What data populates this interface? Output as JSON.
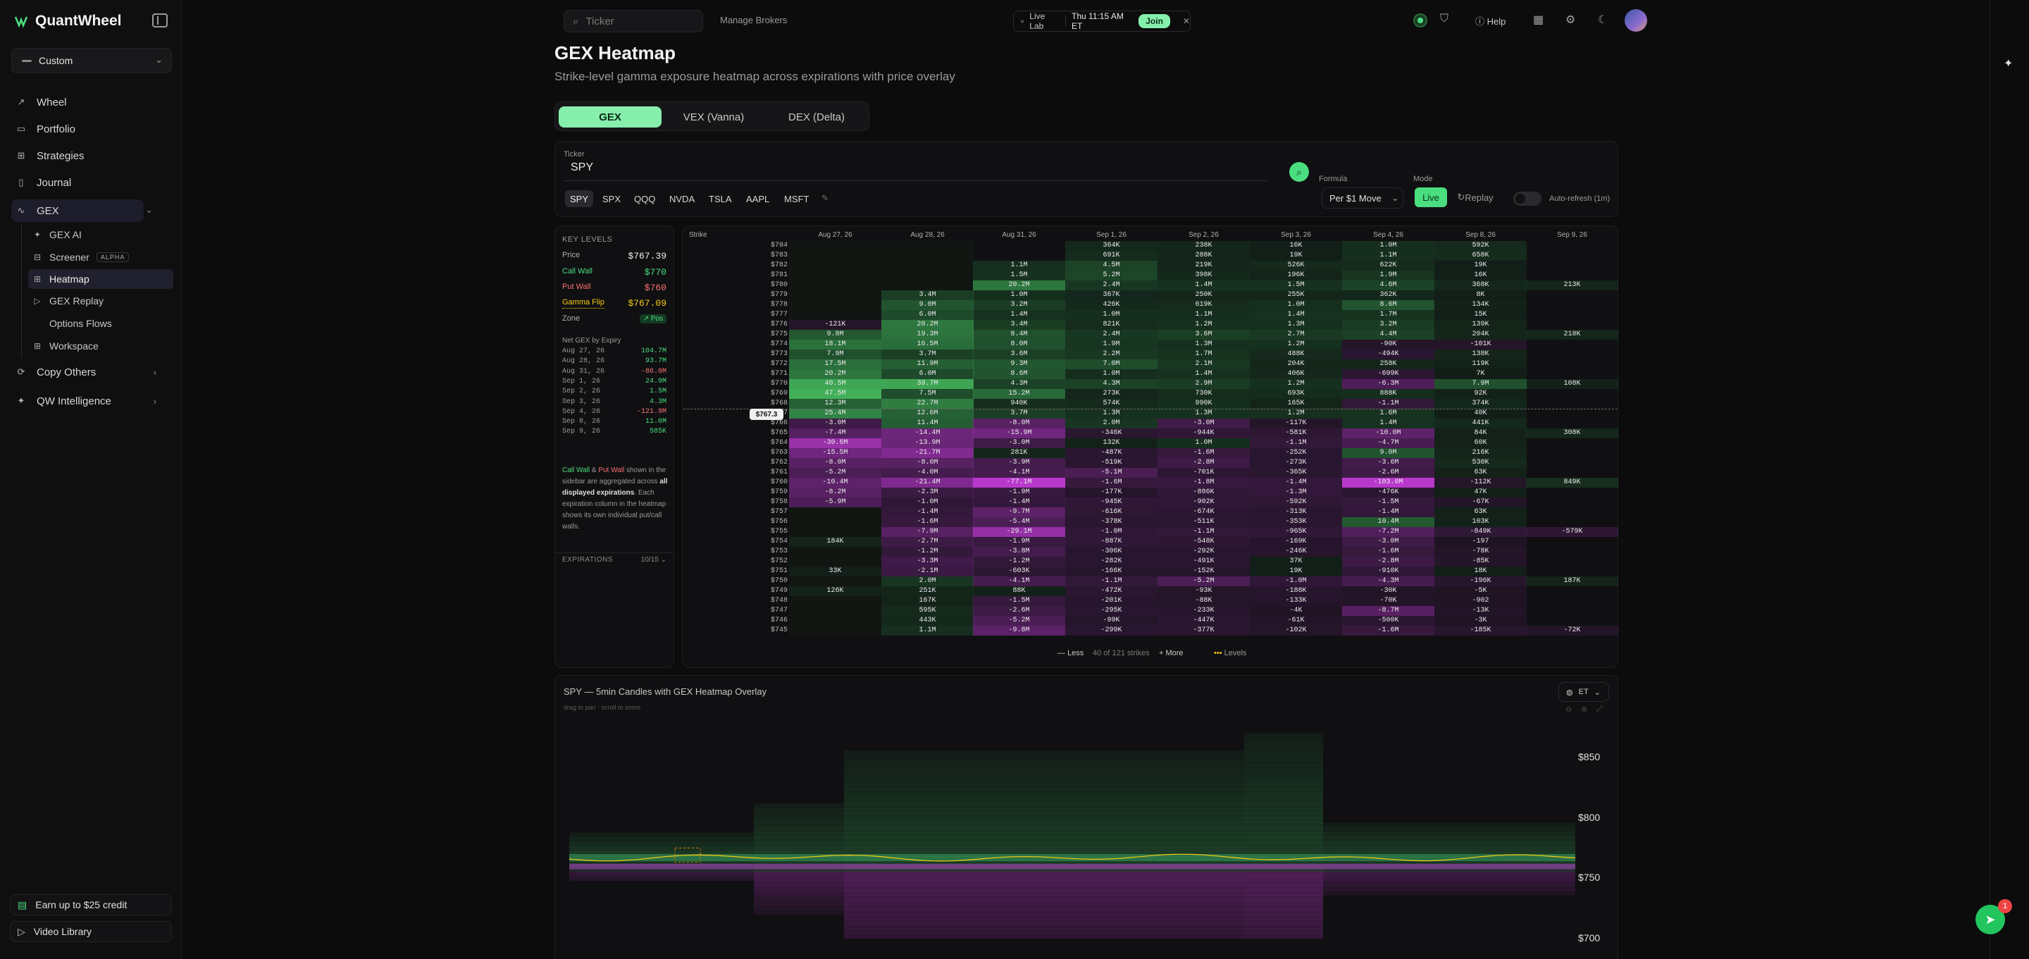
{
  "app": {
    "name": "QuantWheel"
  },
  "sidebar": {
    "preset": "Custom",
    "items": [
      {
        "label": "Wheel",
        "icon": "wheel-icon"
      },
      {
        "label": "Portfolio",
        "icon": "portfolio-icon"
      },
      {
        "label": "Strategies",
        "icon": "strategies-icon"
      },
      {
        "label": "Journal",
        "icon": "journal-icon"
      },
      {
        "label": "GEX",
        "icon": "gex-icon"
      },
      {
        "label": "Copy Others",
        "icon": "copy-icon"
      },
      {
        "label": "QW Intelligence",
        "icon": "sparkle-icon"
      }
    ],
    "gex_sub": [
      {
        "label": "GEX AI",
        "icon": "sparkle-icon"
      },
      {
        "label": "Screener",
        "icon": "screener-icon",
        "badge": "ALPHA"
      },
      {
        "label": "Heatmap",
        "icon": "grid-icon"
      },
      {
        "label": "GEX Replay",
        "icon": "play-icon"
      },
      {
        "label": "Options Flows",
        "icon": "flows-icon"
      },
      {
        "label": "Workspace",
        "icon": "workspace-icon"
      }
    ],
    "credit": "Earn up to $25 credit",
    "video": "Video Library"
  },
  "topbar": {
    "ticker_placeholder": "Ticker",
    "manage_brokers": "Manage Brokers",
    "live_lab": "Live Lab",
    "time": "Thu 11:15 AM ET",
    "join": "Join",
    "help": "Help"
  },
  "page": {
    "title": "GEX Heatmap",
    "subtitle": "Strike-level gamma exposure heatmap across expirations with price overlay"
  },
  "tabs": [
    "GEX",
    "VEX (Vanna)",
    "DEX (Delta)"
  ],
  "controls": {
    "ticker_label": "Ticker",
    "ticker_value": "SPY",
    "chips": [
      "SPY",
      "SPX",
      "QQQ",
      "NVDA",
      "TSLA",
      "AAPL",
      "MSFT"
    ],
    "formula_label": "Formula",
    "formula_value": "Per $1 Move",
    "mode_label": "Mode",
    "mode_live": "Live",
    "mode_replay": "Replay",
    "auto_refresh": "Auto-refresh (1m)"
  },
  "key_levels": {
    "title": "KEY LEVELS",
    "price_label": "Price",
    "price": "$767.39",
    "call_wall_label": "Call Wall",
    "call_wall": "$770",
    "put_wall_label": "Put Wall",
    "put_wall": "$760",
    "gamma_flip_label": "Gamma Flip",
    "gamma_flip": "$767.09",
    "zone_label": "Zone",
    "zone": "Pos",
    "net_title": "Net GEX by Expiry",
    "net": [
      {
        "date": "Aug 27, 26",
        "value": "104.7M",
        "color": "#4ade80"
      },
      {
        "date": "Aug 28, 26",
        "value": "93.7M",
        "color": "#4ade80"
      },
      {
        "date": "Aug 31, 26",
        "value": "-86.0M",
        "color": "#f87171"
      },
      {
        "date": "Sep 1, 26",
        "value": "24.9M",
        "color": "#4ade80"
      },
      {
        "date": "Sep 2, 26",
        "value": "1.5M",
        "color": "#4ade80"
      },
      {
        "date": "Sep 3, 26",
        "value": "4.3M",
        "color": "#4ade80"
      },
      {
        "date": "Sep 4, 26",
        "value": "-121.9M",
        "color": "#f87171"
      },
      {
        "date": "Sep 8, 26",
        "value": "11.0M",
        "color": "#4ade80"
      },
      {
        "date": "Sep 9, 26",
        "value": "585K",
        "color": "#4ade80"
      }
    ],
    "note_call": "Call Wall",
    "note_amp": " & ",
    "note_put": "Put Wall",
    "note_a": " shown in the sidebar are aggregated across ",
    "note_bold": "all displayed expirations",
    "note_b": ". Each expiration column in the heatmap shows its own individual put/call walls.",
    "expirations_label": "EXPIRATIONS",
    "expirations_count": "10/15"
  },
  "heatmap": {
    "strike_header": "Strike",
    "columns": [
      "Aug 27, 26",
      "Aug 28, 26",
      "Aug 31, 26",
      "Sep 1, 26",
      "Sep 2, 26",
      "Sep 3, 26",
      "Sep 4, 26",
      "Sep 8, 26",
      "Sep 9, 26"
    ],
    "rows": [
      {
        "strike": "$784",
        "cells": [
          "",
          "",
          "",
          "364K",
          "238K",
          "16K",
          "1.0M",
          "592K",
          ""
        ]
      },
      {
        "strike": "$783",
        "cells": [
          "",
          "",
          "",
          "691K",
          "288K",
          "19K",
          "1.1M",
          "658K",
          ""
        ]
      },
      {
        "strike": "$782",
        "cells": [
          "",
          "",
          "1.1M",
          "4.5M",
          "219K",
          "526K",
          "622K",
          "19K",
          ""
        ]
      },
      {
        "strike": "$781",
        "cells": [
          "",
          "",
          "1.5M",
          "5.2M",
          "398K",
          "196K",
          "1.9M",
          "16K",
          ""
        ]
      },
      {
        "strike": "$780",
        "cells": [
          "",
          "",
          "20.2M",
          "2.4M",
          "1.4M",
          "1.5M",
          "4.6M",
          "368K",
          "213K"
        ]
      },
      {
        "strike": "$779",
        "cells": [
          "",
          "3.4M",
          "1.0M",
          "367K",
          "250K",
          "255K",
          "362K",
          "8K",
          ""
        ]
      },
      {
        "strike": "$778",
        "cells": [
          "",
          "9.0M",
          "3.2M",
          "426K",
          "619K",
          "1.0M",
          "8.6M",
          "134K",
          ""
        ]
      },
      {
        "strike": "$777",
        "cells": [
          "",
          "6.0M",
          "1.4M",
          "1.0M",
          "1.1M",
          "1.4M",
          "1.7M",
          "15K",
          ""
        ]
      },
      {
        "strike": "$776",
        "cells": [
          "-121K",
          "20.2M",
          "3.4M",
          "821K",
          "1.2M",
          "1.3M",
          "3.2M",
          "139K",
          ""
        ]
      },
      {
        "strike": "$775",
        "cells": [
          "9.8M",
          "19.3M",
          "8.4M",
          "2.4M",
          "3.6M",
          "2.7M",
          "4.4M",
          "204K",
          "218K"
        ]
      },
      {
        "strike": "$774",
        "cells": [
          "18.1M",
          "16.5M",
          "8.0M",
          "1.9M",
          "1.3M",
          "1.2M",
          "-90K",
          "-101K",
          ""
        ]
      },
      {
        "strike": "$773",
        "cells": [
          "7.9M",
          "3.7M",
          "3.6M",
          "2.2M",
          "1.7M",
          "488K",
          "-494K",
          "138K",
          ""
        ]
      },
      {
        "strike": "$772",
        "cells": [
          "17.5M",
          "11.9M",
          "9.3M",
          "7.0M",
          "2.1M",
          "204K",
          "258K",
          "119K",
          ""
        ]
      },
      {
        "strike": "$771",
        "cells": [
          "20.2M",
          "6.0M",
          "8.6M",
          "1.0M",
          "1.4M",
          "406K",
          "-699K",
          "7K",
          ""
        ]
      },
      {
        "strike": "$770",
        "cells": [
          "40.5M",
          "39.7M",
          "4.3M",
          "4.3M",
          "2.9M",
          "1.2M",
          "-6.3M",
          "7.9M",
          "108K"
        ]
      },
      {
        "strike": "$769",
        "cells": [
          "47.5M",
          "7.5M",
          "15.2M",
          "273K",
          "730K",
          "693K",
          "888K",
          "92K",
          ""
        ]
      },
      {
        "strike": "$768",
        "cells": [
          "12.3M",
          "22.7M",
          "940K",
          "574K",
          "990K",
          "165K",
          "-1.1M",
          "374K",
          ""
        ]
      },
      {
        "strike": "$767",
        "cells": [
          "25.4M",
          "12.6M",
          "3.7M",
          "1.3M",
          "1.3M",
          "1.2M",
          "1.6M",
          "40K",
          ""
        ]
      },
      {
        "strike": "$766",
        "cells": [
          "-3.0M",
          "11.4M",
          "-8.0M",
          "2.0M",
          "-3.0M",
          "-117K",
          "1.4M",
          "441K",
          ""
        ]
      },
      {
        "strike": "$765",
        "cells": [
          "-7.4M",
          "-14.4M",
          "-15.9M",
          "-346K",
          "-944K",
          "-581K",
          "-10.0M",
          "84K",
          "308K"
        ]
      },
      {
        "strike": "$764",
        "cells": [
          "-30.6M",
          "-13.9M",
          "-3.0M",
          "132K",
          "1.0M",
          "-1.1M",
          "-4.7M",
          "60K",
          ""
        ]
      },
      {
        "strike": "$763",
        "cells": [
          "-15.5M",
          "-21.7M",
          "281K",
          "-487K",
          "-1.6M",
          "-252K",
          "9.0M",
          "216K",
          ""
        ]
      },
      {
        "strike": "$762",
        "cells": [
          "-8.0M",
          "-8.0M",
          "-3.9M",
          "-519K",
          "-2.8M",
          "-273K",
          "-3.6M",
          "530K",
          ""
        ]
      },
      {
        "strike": "$761",
        "cells": [
          "-5.2M",
          "-4.0M",
          "-4.1M",
          "-5.1M",
          "-701K",
          "-365K",
          "-2.6M",
          "63K",
          ""
        ]
      },
      {
        "strike": "$760",
        "cells": [
          "-10.4M",
          "-21.4M",
          "-77.1M",
          "-1.6M",
          "-1.8M",
          "-1.4M",
          "-103.0M",
          "-112K",
          "849K"
        ]
      },
      {
        "strike": "$759",
        "cells": [
          "-8.2M",
          "-2.3M",
          "-1.9M",
          "-177K",
          "-886K",
          "-1.3M",
          "-476K",
          "47K",
          ""
        ]
      },
      {
        "strike": "$758",
        "cells": [
          "-5.9M",
          "-1.0M",
          "-1.4M",
          "-945K",
          "-902K",
          "-592K",
          "-1.5M",
          "-67K",
          ""
        ]
      },
      {
        "strike": "$757",
        "cells": [
          "",
          "-1.4M",
          "-9.7M",
          "-616K",
          "-674K",
          "-313K",
          "-1.4M",
          "63K",
          ""
        ]
      },
      {
        "strike": "$756",
        "cells": [
          "",
          "-1.6M",
          "-5.4M",
          "-378K",
          "-511K",
          "-353K",
          "10.4M",
          "103K",
          ""
        ]
      },
      {
        "strike": "$755",
        "cells": [
          "",
          "-7.9M",
          "-29.1M",
          "-1.0M",
          "-1.1M",
          "-965K",
          "-7.2M",
          "-849K",
          "-579K"
        ]
      },
      {
        "strike": "$754",
        "cells": [
          "184K",
          "-2.7M",
          "-1.9M",
          "-887K",
          "-548K",
          "-169K",
          "-3.0M",
          "-197",
          ""
        ]
      },
      {
        "strike": "$753",
        "cells": [
          "",
          "-1.2M",
          "-3.8M",
          "-306K",
          "-292K",
          "-246K",
          "-1.6M",
          "-78K",
          ""
        ]
      },
      {
        "strike": "$752",
        "cells": [
          "",
          "-3.3M",
          "-1.2M",
          "-282K",
          "-491K",
          "37K",
          "-2.8M",
          "-85K",
          ""
        ]
      },
      {
        "strike": "$751",
        "cells": [
          "33K",
          "-2.1M",
          "-603K",
          "-166K",
          "-152K",
          "19K",
          "-910K",
          "18K",
          ""
        ]
      },
      {
        "strike": "$750",
        "cells": [
          "",
          "2.0M",
          "-4.1M",
          "-1.1M",
          "-5.2M",
          "-1.0M",
          "-4.3M",
          "-196K",
          "187K"
        ]
      },
      {
        "strike": "$749",
        "cells": [
          "126K",
          "251K",
          "88K",
          "-472K",
          "-93K",
          "-188K",
          "-30K",
          "-5K",
          ""
        ]
      },
      {
        "strike": "$748",
        "cells": [
          "",
          "167K",
          "-1.5M",
          "-201K",
          "-88K",
          "-133K",
          "-70K",
          "-902",
          ""
        ]
      },
      {
        "strike": "$747",
        "cells": [
          "",
          "595K",
          "-2.6M",
          "-295K",
          "-233K",
          "-4K",
          "-8.7M",
          "-13K",
          ""
        ]
      },
      {
        "strike": "$746",
        "cells": [
          "",
          "443K",
          "-5.2M",
          "-99K",
          "-447K",
          "-61K",
          "-500K",
          "-3K",
          ""
        ]
      },
      {
        "strike": "$745",
        "cells": [
          "",
          "1.1M",
          "-9.8M",
          "-299K",
          "-377K",
          "-102K",
          "-1.6M",
          "-185K",
          "-72K"
        ]
      }
    ],
    "current_price_label": "$767.3",
    "less": "Less",
    "count": "40 of 121 strikes",
    "more": "More",
    "levels": "Levels"
  },
  "candle_chart": {
    "title": "SPY — 5min Candles with GEX Heatmap Overlay",
    "hint": "drag to pan · scroll to zoom",
    "tz": "ET",
    "y_ticks": [
      "$850",
      "$800",
      "$750",
      "$700"
    ]
  },
  "chat_badge": "1"
}
